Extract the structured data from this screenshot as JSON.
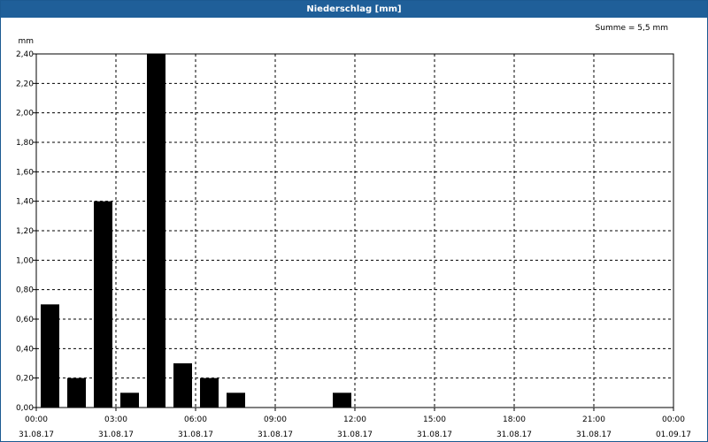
{
  "chart_data": {
    "type": "bar",
    "title": "Niederschlag [mm]",
    "ylabel": "mm",
    "annotation": "Summe = 5,5 mm",
    "ylim": [
      0,
      2.4
    ],
    "yticks": [
      "0,00",
      "0,20",
      "0,40",
      "0,60",
      "0,80",
      "1,00",
      "1,20",
      "1,40",
      "1,60",
      "1,80",
      "2,00",
      "2,20",
      "2,40"
    ],
    "xticks": [
      {
        "time": "00:00",
        "date": "31.08.17"
      },
      {
        "time": "03:00",
        "date": "31.08.17"
      },
      {
        "time": "06:00",
        "date": "31.08.17"
      },
      {
        "time": "09:00",
        "date": "31.08.17"
      },
      {
        "time": "12:00",
        "date": "31.08.17"
      },
      {
        "time": "15:00",
        "date": "31.08.17"
      },
      {
        "time": "18:00",
        "date": "31.08.17"
      },
      {
        "time": "21:00",
        "date": "31.08.17"
      },
      {
        "time": "00:00",
        "date": "01.09.17"
      }
    ],
    "hours": [
      "00:00",
      "01:00",
      "02:00",
      "03:00",
      "04:00",
      "05:00",
      "06:00",
      "07:00",
      "08:00",
      "09:00",
      "10:00",
      "11:00",
      "12:00",
      "13:00",
      "14:00",
      "15:00",
      "16:00",
      "17:00",
      "18:00",
      "19:00",
      "20:00",
      "21:00",
      "22:00",
      "23:00"
    ],
    "values": [
      0.7,
      0.2,
      1.4,
      0.1,
      2.4,
      0.3,
      0.2,
      0.1,
      0,
      0,
      0,
      0.1,
      0,
      0,
      0,
      0,
      0,
      0,
      0,
      0,
      0,
      0,
      0,
      0
    ],
    "grid": true,
    "bar_color": "#000000"
  }
}
